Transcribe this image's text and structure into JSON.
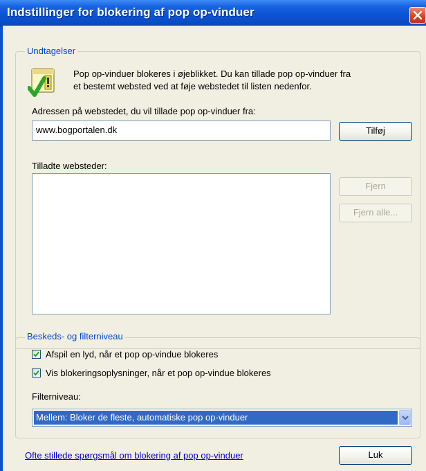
{
  "window": {
    "title": "Indstillinger for blokering af pop op-vinduer"
  },
  "exceptions": {
    "legend": "Undtagelser",
    "info_line1": "Pop op-vinduer blokeres i øjeblikket. Du kan tillade pop op-vinduer fra",
    "info_line2": "et bestemt websted ved at føje webstedet til listen nedenfor.",
    "address_label": "Adressen på webstedet, du vil tillade pop op-vinduer fra:",
    "address_value": "www.bogportalen.dk",
    "add_button": "Tilføj",
    "allowed_label": "Tilladte websteder:",
    "allowed_sites": [],
    "remove_button": "Fjern",
    "remove_all_button": "Fjern alle..."
  },
  "filter": {
    "legend": "Beskeds- og filterniveau",
    "play_sound_label": "Afspil en lyd, når et pop op-vindue blokeres",
    "play_sound_checked": true,
    "show_info_label": "Vis blokeringsoplysninger, når et pop op-vindue blokeres",
    "show_info_checked": true,
    "level_label": "Filterniveau:",
    "level_value": "Mellem: Bloker de fleste, automatiske pop op-vinduer"
  },
  "footer": {
    "faq_link": "Ofte stillede spørgsmål om blokering af pop op-vinduer",
    "close_button": "Luk"
  },
  "icons": {
    "window_close": "close-icon",
    "info": "shield-check-icon",
    "checkbox": "checkmark-icon",
    "dropdown": "chevron-down-icon"
  },
  "colors": {
    "titlebar": "#0b55d6",
    "dialog_bg": "#f1efe2",
    "legend_text": "#0046d5",
    "selection": "#316ac5",
    "link": "#0000cc"
  }
}
